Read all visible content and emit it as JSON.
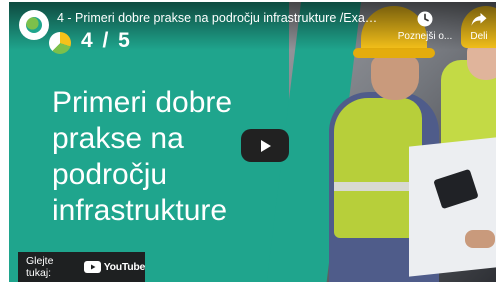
{
  "header": {
    "title": "4 - Primeri dobre prakse na področju infrastrukture /Examples...",
    "watch_later_label": "Poznejši o...",
    "share_label": "Deli"
  },
  "slide": {
    "counter": "4 / 5",
    "heading": "Primeri dobre prakse na področju infrastrukture"
  },
  "watch_on": {
    "label": "Glejte tukaj:",
    "brand": "YouTube"
  },
  "colors": {
    "slide_background": "#1fa58d",
    "play_button": "#212121",
    "helmet": "#f6c21a",
    "vest": "#b7cf3a"
  },
  "icons": {
    "header": [
      "channel-avatar",
      "clock-icon",
      "share-arrow-icon"
    ],
    "center": "play-icon",
    "brand": "youtube-logo-icon"
  }
}
